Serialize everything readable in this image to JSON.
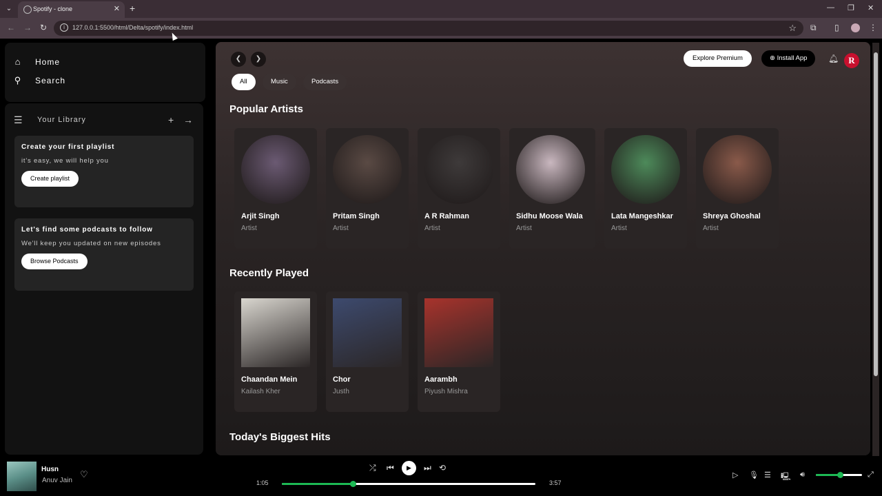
{
  "browser": {
    "tab_title": "Spotify - clone",
    "url": "127.0.0.1:5500/html/Delta/spotify/index.html"
  },
  "sidebar": {
    "home": "Home",
    "search": "Search",
    "library_title": "Your Library",
    "playlist_card": {
      "title": "Create your first playlist",
      "subtitle": "it's easy, we will help you",
      "button": "Create playlist"
    },
    "podcast_card": {
      "title": "Let's find some podcasts to follow",
      "subtitle": "We'll keep you updated on new episodes",
      "button": "Browse Podcasts"
    }
  },
  "header": {
    "chips": [
      "All",
      "Music",
      "Podcasts"
    ],
    "explore_premium": "Explore Premium",
    "install_app": "Install App",
    "avatar_letter": "R"
  },
  "sections": {
    "popular_artists": {
      "title": "Popular Artists",
      "items": [
        {
          "name": "Arjit Singh",
          "sub": "Artist",
          "color": "#6b5a73"
        },
        {
          "name": "Pritam Singh",
          "sub": "Artist",
          "color": "#5a4a44"
        },
        {
          "name": "A R Rahman",
          "sub": "Artist",
          "color": "#3e3a3a"
        },
        {
          "name": "Sidhu Moose Wala",
          "sub": "Artist",
          "color": "#c9b7bf"
        },
        {
          "name": "Lata Mangeshkar",
          "sub": "Artist",
          "color": "#4d8a5a"
        },
        {
          "name": "Shreya Ghoshal",
          "sub": "Artist",
          "color": "#8a5a4a"
        }
      ]
    },
    "recently_played": {
      "title": "Recently Played",
      "items": [
        {
          "name": "Chaandan Mein",
          "sub": "Kailash Kher",
          "color": "#d9d6cf"
        },
        {
          "name": "Chor",
          "sub": "Justh",
          "color": "#3d4a6e"
        },
        {
          "name": "Aarambh",
          "sub": "Piyush Mishra",
          "color": "#a8332c"
        }
      ]
    },
    "todays_hits": {
      "title": "Today's Biggest Hits"
    }
  },
  "player": {
    "title": "Husn",
    "artist": "Anuv Jain",
    "elapsed": "1:05",
    "duration": "3:57",
    "progress_fraction": 0.28,
    "volume_fraction": 0.52,
    "accent": "#1db954"
  }
}
